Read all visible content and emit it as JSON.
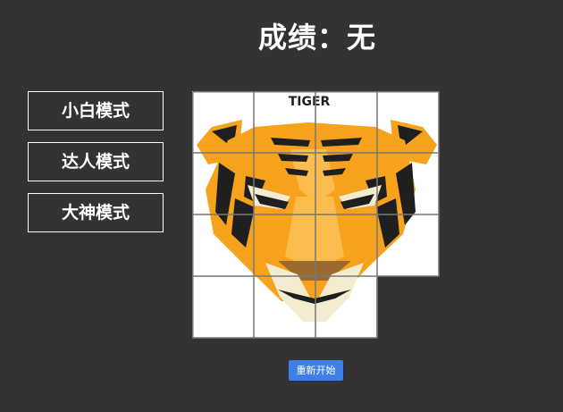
{
  "score": {
    "label": "成绩：",
    "value": "无"
  },
  "modes": [
    {
      "label": "小白模式"
    },
    {
      "label": "达人模式"
    },
    {
      "label": "大神模式"
    }
  ],
  "puzzle": {
    "image_title": "TIGER",
    "grid_rows": 4,
    "grid_cols": 4,
    "empty_tile": "row 4, col 4",
    "colors": {
      "orange": "#f7a21d",
      "dark": "#1f1f1f",
      "cream": "#f4ecd0",
      "light_orange": "#fbbd4d",
      "grid_line": "#777777"
    }
  },
  "restart": {
    "label": "重新开始",
    "color": "#3f7fe6"
  }
}
